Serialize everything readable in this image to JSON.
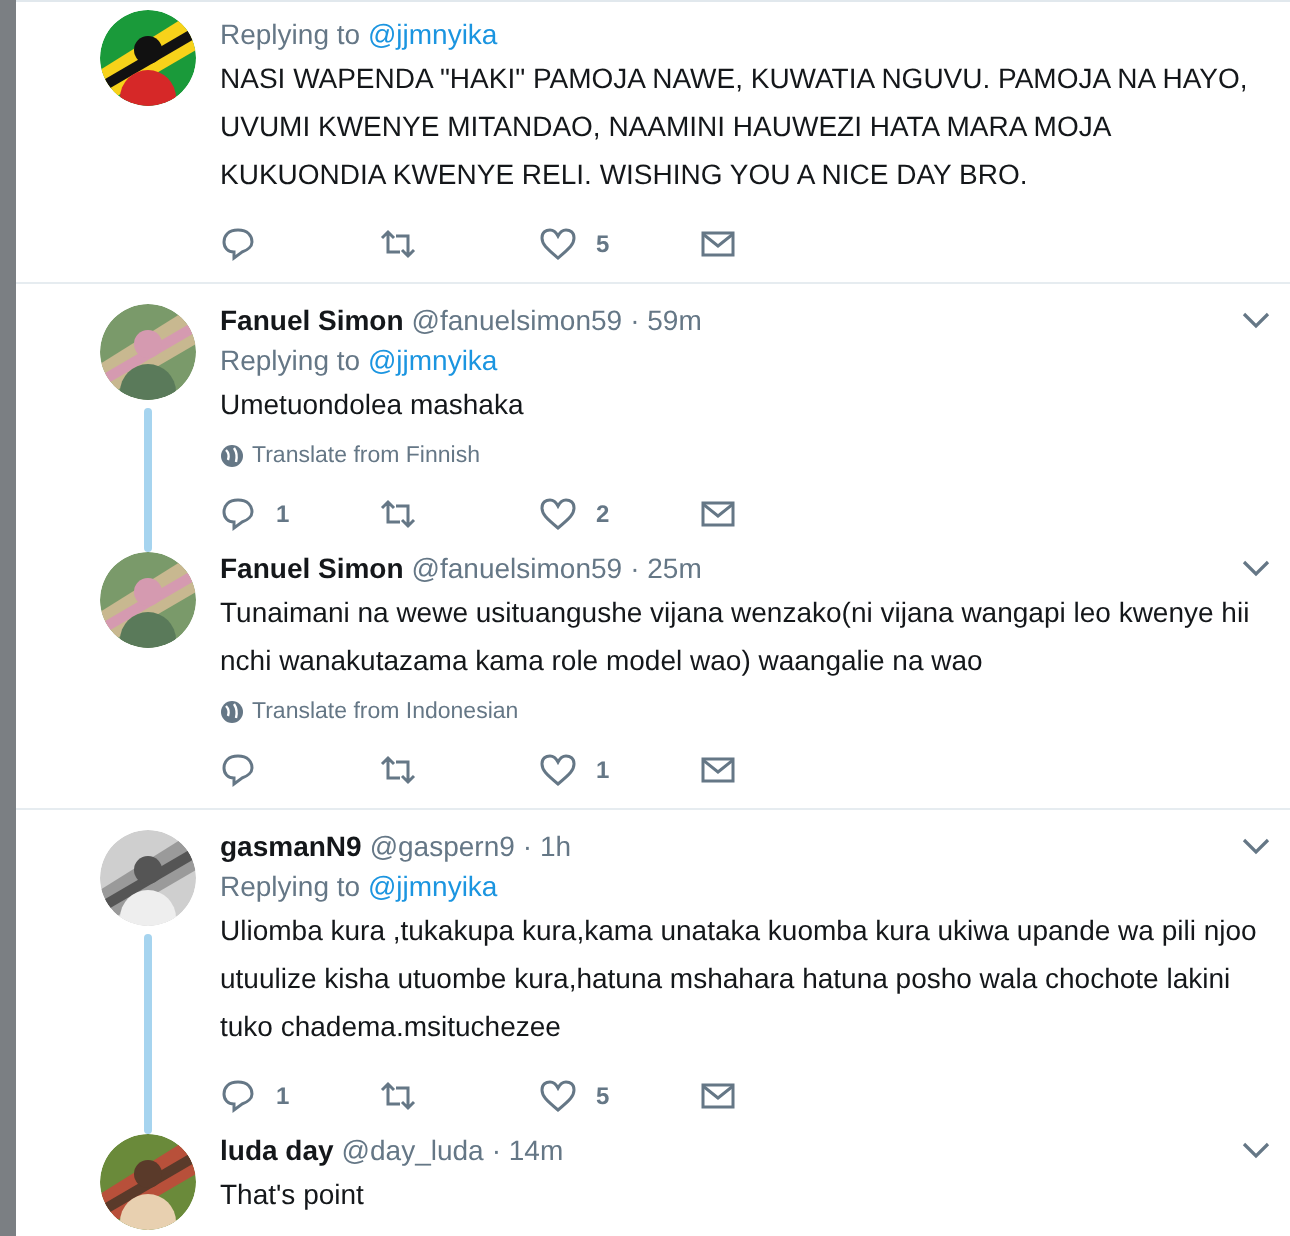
{
  "tweets": [
    {
      "replying_label": "Replying to",
      "replying_to": "@jjmnyika",
      "text": "NASI WAPENDA \"HAKI\" PAMOJA NAWE, KUWATIA NGUVU. PAMOJA NA HAYO, UVUMI KWENYE MITANDAO, NAAMINI HAUWEZI HATA MARA MOJA KUKUONDIA KWENYE RELI. WISHING YOU A NICE DAY BRO.",
      "likes": "5",
      "thread_line": false,
      "divider_after": true,
      "actions_shown": true
    },
    {
      "name": "Fanuel Simon",
      "handle": "@fanuelsimon59",
      "time": "· 59m",
      "replying_label": "Replying to",
      "replying_to": "@jjmnyika",
      "text": "Umetuondolea mashaka",
      "translate": "Translate from Finnish",
      "replies": "1",
      "likes": "2",
      "thread_line": true,
      "divider_after": false,
      "actions_shown": true
    },
    {
      "name": "Fanuel Simon",
      "handle": "@fanuelsimon59",
      "time": "· 25m",
      "text": "Tunaimani na wewe usituangushe vijana wenzako(ni vijana wangapi leo kwenye hii nchi wanakutazama kama role model wao) waangalie na wao",
      "translate": "Translate from Indonesian",
      "likes": "1",
      "thread_line": false,
      "divider_after": true,
      "actions_shown": true
    },
    {
      "name": "gasmanN9",
      "handle": "@gaspern9",
      "time": "· 1h",
      "replying_label": "Replying to",
      "replying_to": "@jjmnyika",
      "text": "Uliomba kura ,tukakupa kura,kama unataka kuomba kura ukiwa upande wa pili njoo utuulize kisha utuombe kura,hatuna mshahara hatuna posho wala chochote lakini tuko chadema.msituchezee",
      "replies": "1",
      "likes": "5",
      "thread_line": true,
      "divider_after": false,
      "actions_shown": true
    },
    {
      "name": "luda day",
      "handle": "@day_luda",
      "time": "· 14m",
      "text": "That's point",
      "thread_line": false,
      "divider_after": false,
      "actions_shown": false
    }
  ]
}
